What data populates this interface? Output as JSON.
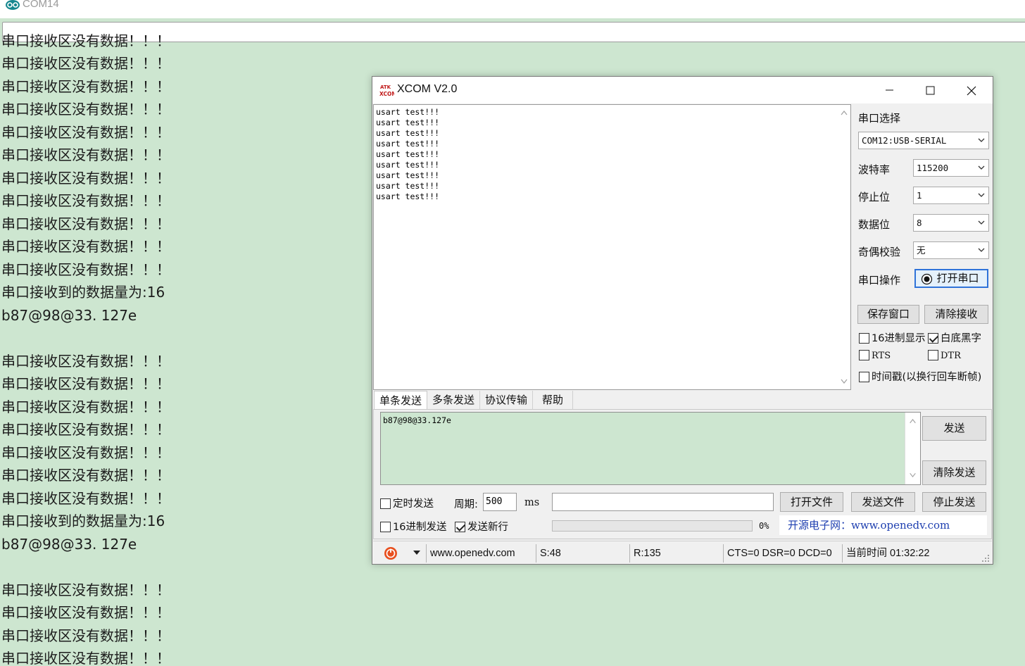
{
  "arduino": {
    "title": "COM14",
    "output_lines": [
      "串口接收区没有数据！！！",
      "串口接收区没有数据！！！",
      "串口接收区没有数据！！！",
      "串口接收区没有数据！！！",
      "串口接收区没有数据！！！",
      "串口接收区没有数据！！！",
      "串口接收区没有数据！！！",
      "串口接收区没有数据！！！",
      "串口接收区没有数据！！！",
      "串口接收区没有数据！！！",
      "串口接收到的数据量为:16",
      "b87@98@33. 127e",
      "",
      "串口接收区没有数据！！！",
      "串口接收区没有数据！！！",
      "串口接收区没有数据！！！",
      "串口接收区没有数据！！！",
      "串口接收区没有数据！！！",
      "串口接收区没有数据！！！",
      "串口接收区没有数据！！！",
      "串口接收到的数据量为:16",
      "b87@98@33. 127e",
      "",
      "串口接收区没有数据！！！",
      "串口接收区没有数据！！！",
      "串口接收区没有数据！！！",
      "串口接收区没有数据！！！"
    ]
  },
  "xcom": {
    "title": "XCOM V2.0",
    "receive_text": "usart test!!!\nusart test!!!\nusart test!!!\nusart test!!!\nusart test!!!\nusart test!!!\nusart test!!!\nusart test!!!\nusart test!!!",
    "side": {
      "port_select_label": "串口选择",
      "port_value": "COM12:USB-SERIAL",
      "baud_label": "波特率",
      "baud_value": "115200",
      "stopbits_label": "停止位",
      "stopbits_value": "1",
      "databits_label": "数据位",
      "databits_value": "8",
      "parity_label": "奇偶校验",
      "parity_value": "无",
      "port_op_label": "串口操作",
      "open_port_button": "打开串口",
      "save_window_button": "保存窗口",
      "clear_receive_button": "清除接收",
      "hex_display_label": "16进制显示",
      "white_bg_label": "白底黑字",
      "rts_label": "RTS",
      "dtr_label": "DTR",
      "timestamp_label": "时间戳(以换行回车断帧)"
    },
    "tabs": [
      "单条发送",
      "多条发送",
      "协议传输",
      "帮助"
    ],
    "send": {
      "text": "b87@98@33.127e",
      "send_button": "发送",
      "clear_send_button": "清除发送",
      "timed_send_label": "定时发送",
      "period_label": "周期:",
      "period_value": "500",
      "period_unit": "ms",
      "open_file_button": "打开文件",
      "send_file_button": "发送文件",
      "stop_send_button": "停止发送",
      "hex_send_label": "16进制发送",
      "send_newline_label": "发送新行",
      "progress_text": "0%",
      "promo": "开源电子网：www.openedv.com"
    },
    "status": {
      "url": "www.openedv.com",
      "sent": "S:48",
      "received": "R:135",
      "lines": "CTS=0 DSR=0 DCD=0",
      "time": "当前时间 01:32:22"
    },
    "checkbox_state": {
      "hex_display": false,
      "white_bg": true,
      "rts": false,
      "dtr": false,
      "timestamp": false,
      "timed_send": false,
      "hex_send": false,
      "send_newline": true
    }
  }
}
